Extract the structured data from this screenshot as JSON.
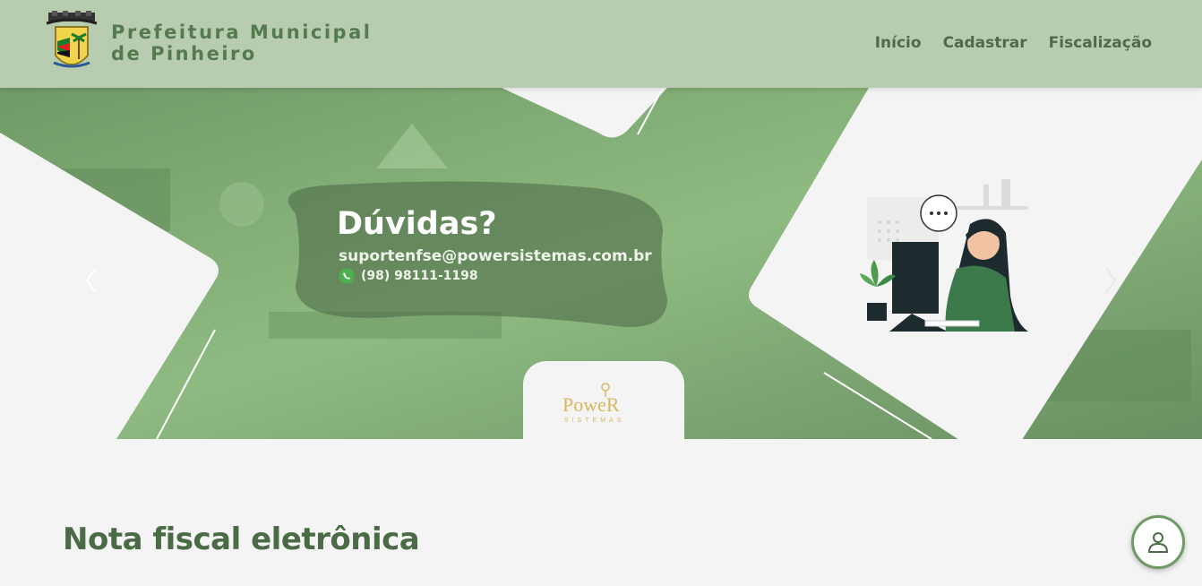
{
  "header": {
    "brand_line1": "Prefeitura Municipal",
    "brand_line2": "de Pinheiro",
    "nav": [
      {
        "label": "Início"
      },
      {
        "label": "Cadastrar"
      },
      {
        "label": "Fiscalização"
      }
    ]
  },
  "hero": {
    "heading": "Dúvidas?",
    "email": "suportenfse@powersistemas.com.br",
    "phone": "(98) 98111-1198",
    "logo_text": "PoweR",
    "logo_subtext": "SISTEMAS"
  },
  "main": {
    "section_title": "Nota fiscal eletrônica"
  },
  "icons": {
    "crest": "municipal-crest-icon",
    "whatsapp": "whatsapp-icon",
    "user": "user-icon",
    "prev": "chevron-left-icon",
    "next": "chevron-right-icon"
  },
  "colors": {
    "header_bg": "#b8cdb0",
    "brand_text": "#557a4f",
    "hero_green": "#7fa674",
    "title_green": "#4b6b46"
  }
}
